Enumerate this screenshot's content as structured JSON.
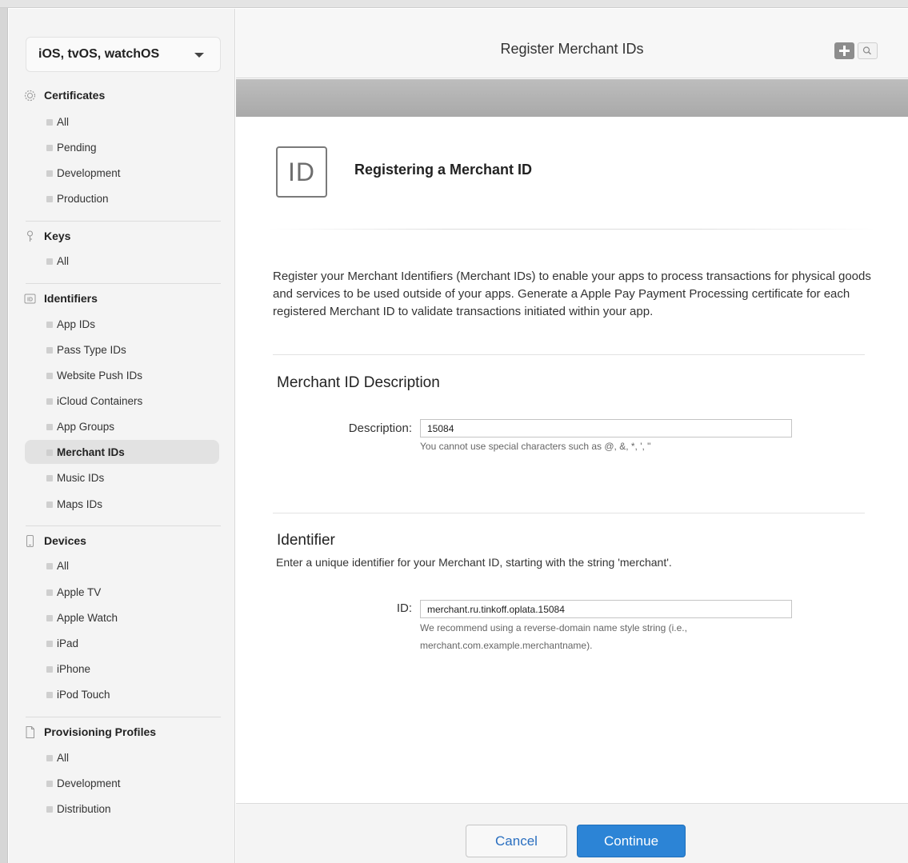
{
  "sidebar": {
    "platform": "iOS, tvOS, watchOS",
    "groups": {
      "certificates": {
        "title": "Certificates",
        "items": [
          "All",
          "Pending",
          "Development",
          "Production"
        ]
      },
      "keys": {
        "title": "Keys",
        "items": [
          "All"
        ]
      },
      "identifiers": {
        "title": "Identifiers",
        "items": [
          "App IDs",
          "Pass Type IDs",
          "Website Push IDs",
          "iCloud Containers",
          "App Groups",
          "Merchant IDs",
          "Music IDs",
          "Maps IDs"
        ]
      },
      "devices": {
        "title": "Devices",
        "items": [
          "All",
          "Apple TV",
          "Apple Watch",
          "iPad",
          "iPhone",
          "iPod Touch"
        ]
      },
      "profiles": {
        "title": "Provisioning Profiles",
        "items": [
          "All",
          "Development",
          "Distribution"
        ]
      }
    },
    "selected": "Merchant IDs"
  },
  "header": {
    "title": "Register Merchant IDs",
    "add_icon": "plus-icon",
    "search_icon": "search-icon"
  },
  "main": {
    "badge_text": "ID",
    "heading": "Registering a Merchant ID",
    "intro": "Register your Merchant Identifiers (Merchant IDs) to enable your apps to process transactions for physical goods and services to be used outside of your apps. Generate a Apple Pay Payment Processing certificate for each registered Merchant ID to validate transactions initiated within your app.",
    "description_section": {
      "title": "Merchant ID Description",
      "label": "Description:",
      "value": "15084",
      "hint": "You cannot use special characters such as @, &, *, ', \""
    },
    "identifier_section": {
      "title": "Identifier",
      "instruction": "Enter a unique identifier for your Merchant ID, starting with the string 'merchant'.",
      "label": "ID:",
      "value": "merchant.ru.tinkoff.oplata.15084",
      "hint_line1": "We recommend using a reverse-domain name style string (i.e.,",
      "hint_line2": "merchant.com.example.merchantname)."
    }
  },
  "footer": {
    "cancel": "Cancel",
    "continue": "Continue"
  },
  "colors": {
    "accent": "#2c84d6",
    "selected_bg": "#e2e2e2"
  }
}
